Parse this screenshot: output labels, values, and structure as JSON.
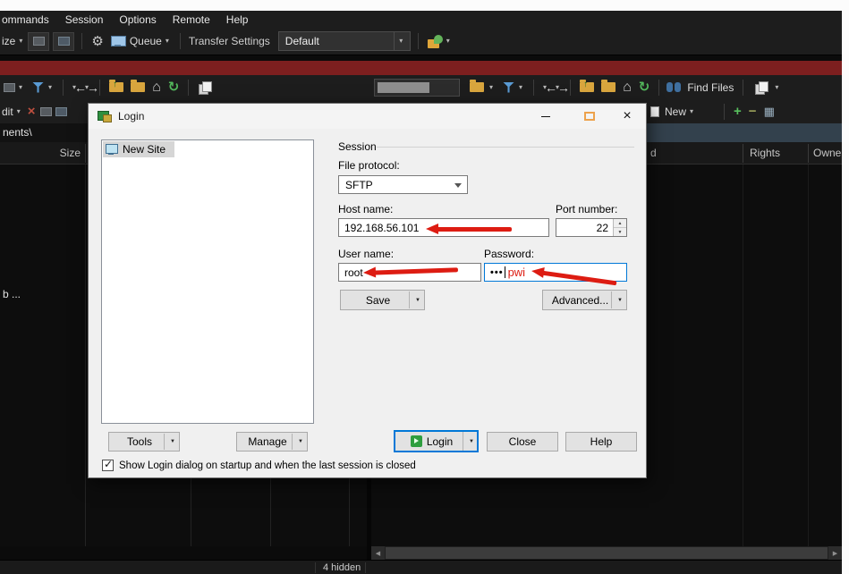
{
  "menubar": {
    "items": [
      "ommands",
      "Session",
      "Options",
      "Remote",
      "Help"
    ]
  },
  "toolbar_top": {
    "synchronize_label": "ize",
    "queue_label": "Queue",
    "transfer_settings_label": "Transfer Settings",
    "transfer_settings_value": "Default"
  },
  "toolbar_nav": {
    "find_files_label": "Find Files"
  },
  "commands_row": {
    "edit_label": "dit",
    "new_label": "New"
  },
  "left_panel": {
    "path": "nents\\",
    "size_column": "Size",
    "file_item": "b ..."
  },
  "right_panel": {
    "col_changed": "d",
    "col_rights": "Rights",
    "col_owner": "Owner"
  },
  "dialog": {
    "title": "Login",
    "new_site_label": "New Site",
    "session_group": "Session",
    "file_protocol_label": "File protocol:",
    "file_protocol_value": "SFTP",
    "host_label": "Host name:",
    "host_value": "192.168.56.101",
    "port_label": "Port number:",
    "port_value": "22",
    "user_label": "User name:",
    "user_value": "root",
    "password_label": "Password:",
    "password_masked": "•••",
    "password_annotation": "pwi",
    "save_button": "Save",
    "advanced_button": "Advanced...",
    "tools_button": "Tools",
    "manage_button": "Manage",
    "login_button": "Login",
    "close_button": "Close",
    "help_button": "Help",
    "startup_checkbox_label": "Show Login dialog on startup and when the last session is closed"
  },
  "statusbar": {
    "hidden_count": "4 hidden"
  },
  "icons": {
    "gear": "⚙",
    "back_arrow": "←",
    "forward_arrow": "→",
    "refresh": "↻",
    "home": "⌂",
    "delete_x": "×",
    "caret_down": "▾",
    "scroll_left": "◀",
    "scroll_right": "▶",
    "check": "✓",
    "close": "×",
    "plus": "+",
    "minus": "−",
    "grid": "▦",
    "spinner_up": "▲",
    "spinner_down": "▼"
  },
  "colors": {
    "red_band": "#7d1f1f",
    "annotation_red": "#dd1c12",
    "focus_blue": "#0078d7"
  }
}
